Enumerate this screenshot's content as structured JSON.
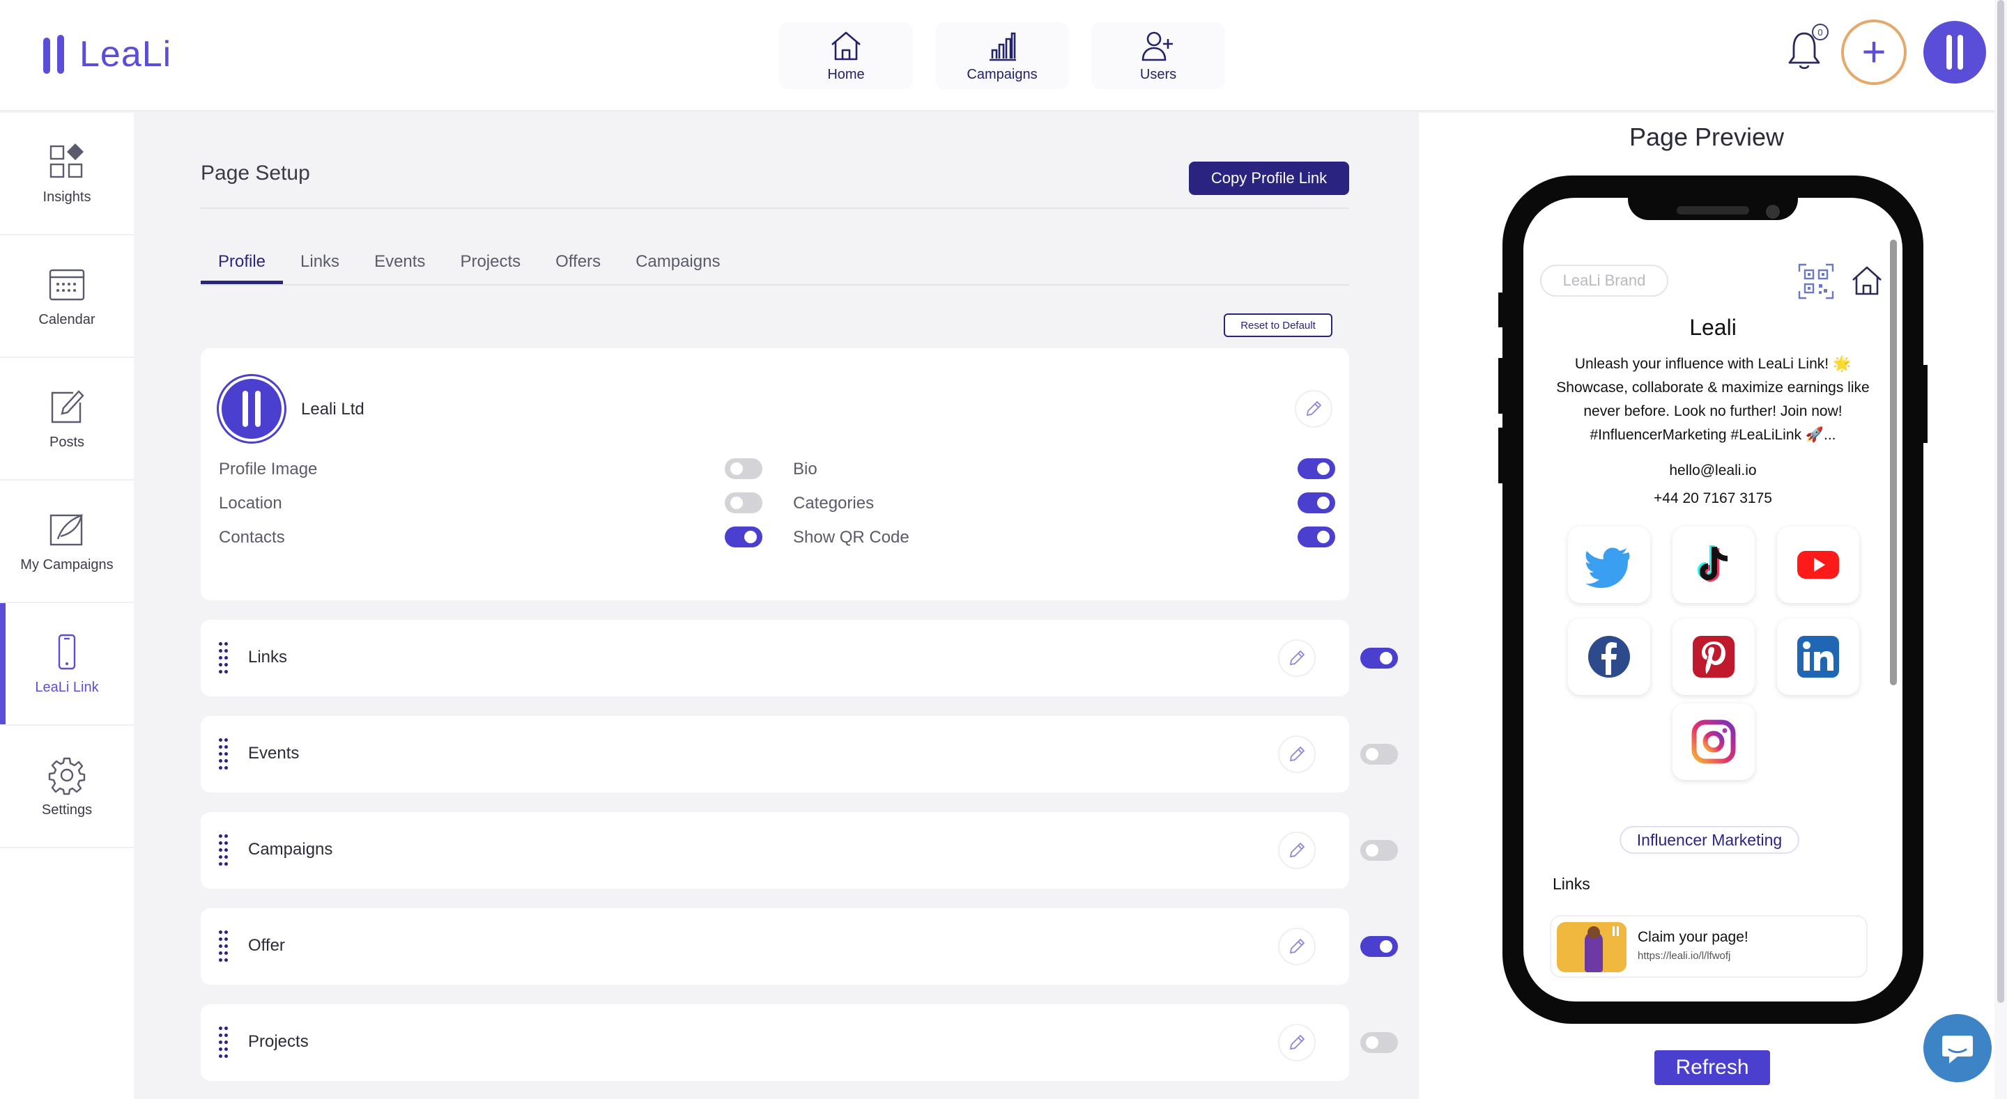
{
  "brand": {
    "name": "LeaLi",
    "accent": "#5a4ed8",
    "dark": "#2a2480"
  },
  "topnav": [
    {
      "label": "Home",
      "icon": "home-icon"
    },
    {
      "label": "Campaigns",
      "icon": "bar-chart-icon"
    },
    {
      "label": "Users",
      "icon": "user-plus-icon"
    }
  ],
  "notifications": {
    "count": "0"
  },
  "sidebar": {
    "items": [
      {
        "label": "Insights",
        "icon": "grid-icon"
      },
      {
        "label": "Calendar",
        "icon": "calendar-icon"
      },
      {
        "label": "Posts",
        "icon": "edit-icon"
      },
      {
        "label": "My Campaigns",
        "icon": "feather-icon"
      },
      {
        "label": "LeaLi Link",
        "icon": "phone-icon",
        "active": true
      },
      {
        "label": "Settings",
        "icon": "gear-icon"
      }
    ]
  },
  "page": {
    "title": "Page Setup",
    "copy_button": "Copy Profile Link",
    "tabs": [
      "Profile",
      "Links",
      "Events",
      "Projects",
      "Offers",
      "Campaigns"
    ],
    "active_tab": "Profile",
    "reset_button": "Reset to Default"
  },
  "profile": {
    "name": "Leali Ltd",
    "options": [
      {
        "label": "Profile Image",
        "on": false
      },
      {
        "label": "Location",
        "on": false
      },
      {
        "label": "Contacts",
        "on": true
      },
      {
        "label": "Bio",
        "on": true
      },
      {
        "label": "Categories",
        "on": true
      },
      {
        "label": "Show QR Code",
        "on": true
      }
    ]
  },
  "sections": [
    {
      "title": "Links",
      "on": true
    },
    {
      "title": "Events",
      "on": false
    },
    {
      "title": "Campaigns",
      "on": false
    },
    {
      "title": "Offer",
      "on": true
    },
    {
      "title": "Projects",
      "on": false
    }
  ],
  "preview": {
    "title": "Page Preview",
    "brand_pill": "LeaLi Brand",
    "name": "Leali",
    "bio": "Unleash your influence with LeaLi Link! 🌟 Showcase, collaborate & maximize earnings like never before. Look no further! Join now! #InfluencerMarketing #LeaLiLink 🚀...",
    "email": "hello@leali.io",
    "phone": "+44 20 7167 3175",
    "socials": [
      "twitter-icon",
      "tiktok-icon",
      "youtube-icon",
      "facebook-icon",
      "pinterest-icon",
      "linkedin-icon",
      "instagram-icon"
    ],
    "category": "Influencer Marketing",
    "links_heading": "Links",
    "link": {
      "title": "Claim your page!",
      "url": "https://leali.io/l/lfwofj"
    },
    "refresh_button": "Refresh"
  }
}
